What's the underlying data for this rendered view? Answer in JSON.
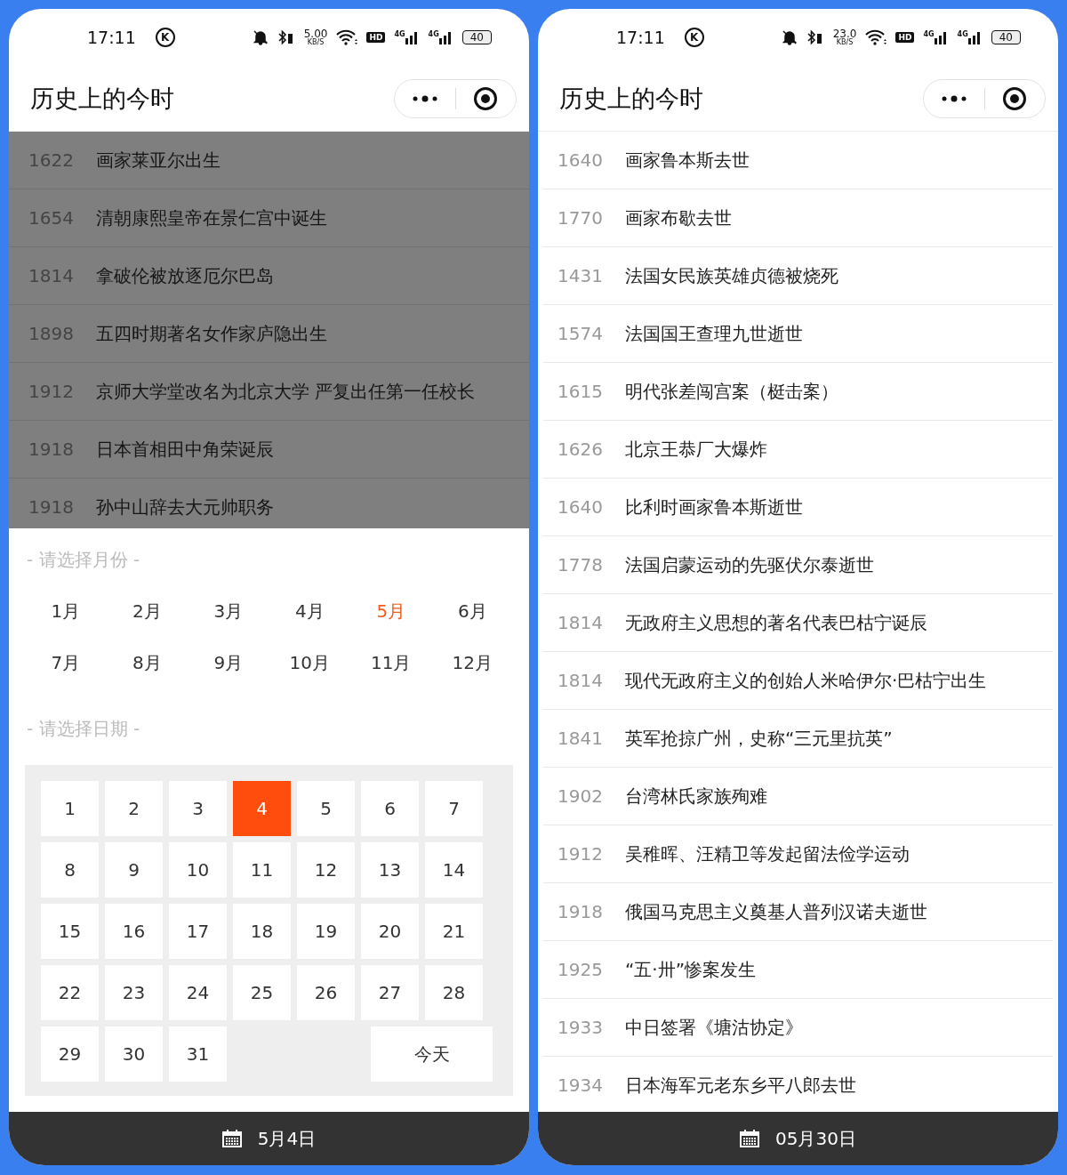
{
  "phones": [
    {
      "status": {
        "time": "17:11",
        "k_mark": "K",
        "speed": "5.00",
        "speed_unit": "KB/S",
        "hd": "HD",
        "sims": [
          "4G",
          "4G"
        ],
        "battery": "40"
      },
      "title": "历史上的今时",
      "dimmed": true,
      "events": [
        {
          "year": "1622",
          "text": "画家莱亚尔出生"
        },
        {
          "year": "1654",
          "text": "清朝康熙皇帝在景仁宫中诞生"
        },
        {
          "year": "1814",
          "text": "拿破伦被放逐厄尔巴岛"
        },
        {
          "year": "1898",
          "text": "五四时期著名女作家庐隐出生"
        },
        {
          "year": "1912",
          "text": "京师大学堂改名为北京大学 严复出任第一任校长"
        },
        {
          "year": "1918",
          "text": "日本首相田中角荣诞辰"
        },
        {
          "year": "1918",
          "text": "孙中山辞去大元帅职务"
        }
      ],
      "picker": {
        "month_label": "- 请选择月份 -",
        "months": [
          {
            "label": "1月",
            "selected": false
          },
          {
            "label": "2月",
            "selected": false
          },
          {
            "label": "3月",
            "selected": false
          },
          {
            "label": "4月",
            "selected": false
          },
          {
            "label": "5月",
            "selected": true
          },
          {
            "label": "6月",
            "selected": false
          },
          {
            "label": "7月",
            "selected": false
          },
          {
            "label": "8月",
            "selected": false
          },
          {
            "label": "9月",
            "selected": false
          },
          {
            "label": "10月",
            "selected": false
          },
          {
            "label": "11月",
            "selected": false
          },
          {
            "label": "12月",
            "selected": false
          }
        ],
        "date_label": "- 请选择日期 -",
        "days": [
          {
            "label": "1",
            "selected": false
          },
          {
            "label": "2",
            "selected": false
          },
          {
            "label": "3",
            "selected": false
          },
          {
            "label": "4",
            "selected": true
          },
          {
            "label": "5",
            "selected": false
          },
          {
            "label": "6",
            "selected": false
          },
          {
            "label": "7",
            "selected": false
          },
          {
            "label": "8",
            "selected": false
          },
          {
            "label": "9",
            "selected": false
          },
          {
            "label": "10",
            "selected": false
          },
          {
            "label": "11",
            "selected": false
          },
          {
            "label": "12",
            "selected": false
          },
          {
            "label": "13",
            "selected": false
          },
          {
            "label": "14",
            "selected": false
          },
          {
            "label": "15",
            "selected": false
          },
          {
            "label": "16",
            "selected": false
          },
          {
            "label": "17",
            "selected": false
          },
          {
            "label": "18",
            "selected": false
          },
          {
            "label": "19",
            "selected": false
          },
          {
            "label": "20",
            "selected": false
          },
          {
            "label": "21",
            "selected": false
          },
          {
            "label": "22",
            "selected": false
          },
          {
            "label": "23",
            "selected": false
          },
          {
            "label": "24",
            "selected": false
          },
          {
            "label": "25",
            "selected": false
          },
          {
            "label": "26",
            "selected": false
          },
          {
            "label": "27",
            "selected": false
          },
          {
            "label": "28",
            "selected": false
          },
          {
            "label": "29",
            "selected": false
          },
          {
            "label": "30",
            "selected": false
          },
          {
            "label": "31",
            "selected": false
          }
        ],
        "today_button": "今天"
      },
      "footer": {
        "date": "5月4日"
      }
    },
    {
      "status": {
        "time": "17:11",
        "k_mark": "K",
        "speed": "23.0",
        "speed_unit": "KB/S",
        "hd": "HD",
        "sims": [
          "4G",
          "4G"
        ],
        "battery": "40"
      },
      "title": "历史上的今时",
      "dimmed": false,
      "events": [
        {
          "year": "1640",
          "text": "画家鲁本斯去世"
        },
        {
          "year": "1770",
          "text": "画家布歇去世"
        },
        {
          "year": "1431",
          "text": "法国女民族英雄贞德被烧死"
        },
        {
          "year": "1574",
          "text": "法国国王查理九世逝世"
        },
        {
          "year": "1615",
          "text": "明代张差闯宫案（梃击案）"
        },
        {
          "year": "1626",
          "text": "北京王恭厂大爆炸"
        },
        {
          "year": "1640",
          "text": "比利时画家鲁本斯逝世"
        },
        {
          "year": "1778",
          "text": "法国启蒙运动的先驱伏尔泰逝世"
        },
        {
          "year": "1814",
          "text": "无政府主义思想的著名代表巴枯宁诞辰"
        },
        {
          "year": "1814",
          "text": "现代无政府主义的创始人米哈伊尔·巴枯宁出生"
        },
        {
          "year": "1841",
          "text": "英军抢掠广州，史称“三元里抗英”"
        },
        {
          "year": "1902",
          "text": "台湾林氏家族殉难"
        },
        {
          "year": "1912",
          "text": "吴稚晖、汪精卫等发起留法俭学运动"
        },
        {
          "year": "1918",
          "text": "俄国马克思主义奠基人普列汉诺夫逝世"
        },
        {
          "year": "1925",
          "text": "“五·卅”惨案发生"
        },
        {
          "year": "1933",
          "text": "中日签署《塘沽协定》"
        },
        {
          "year": "1934",
          "text": "日本海军元老东乡平八郎去世"
        }
      ],
      "footer": {
        "date": "05月30日"
      }
    }
  ]
}
